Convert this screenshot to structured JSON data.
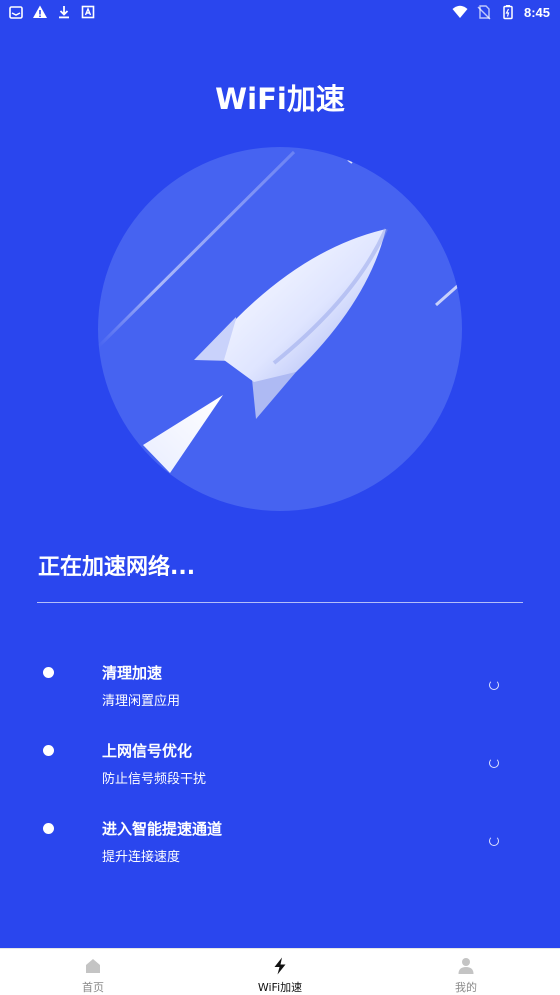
{
  "status_bar": {
    "time": "8:45",
    "left_icons": [
      "notification-box-icon",
      "warning-icon",
      "download-icon",
      "app-badge-icon"
    ],
    "right_icons": [
      "wifi-icon",
      "no-sim-icon",
      "battery-icon"
    ]
  },
  "header": {
    "title": "WiFi加速"
  },
  "hero": {
    "icon": "rocket-icon",
    "circle_color": "#4663f1",
    "background_color": "#2a46ee"
  },
  "progress": {
    "title": "正在加速网络..."
  },
  "tasks": [
    {
      "title": "清理加速",
      "subtitle": "清理闲置应用",
      "state": "loading"
    },
    {
      "title": "上网信号优化",
      "subtitle": "防止信号频段干扰",
      "state": "loading"
    },
    {
      "title": "进入智能提速通道",
      "subtitle": "提升连接速度",
      "state": "loading"
    }
  ],
  "bottom_nav": {
    "items": [
      {
        "label": "首页",
        "icon": "home-icon",
        "active": false
      },
      {
        "label": "WiFi加速",
        "icon": "lightning-icon",
        "active": true
      },
      {
        "label": "我的",
        "icon": "user-icon",
        "active": false
      }
    ]
  }
}
